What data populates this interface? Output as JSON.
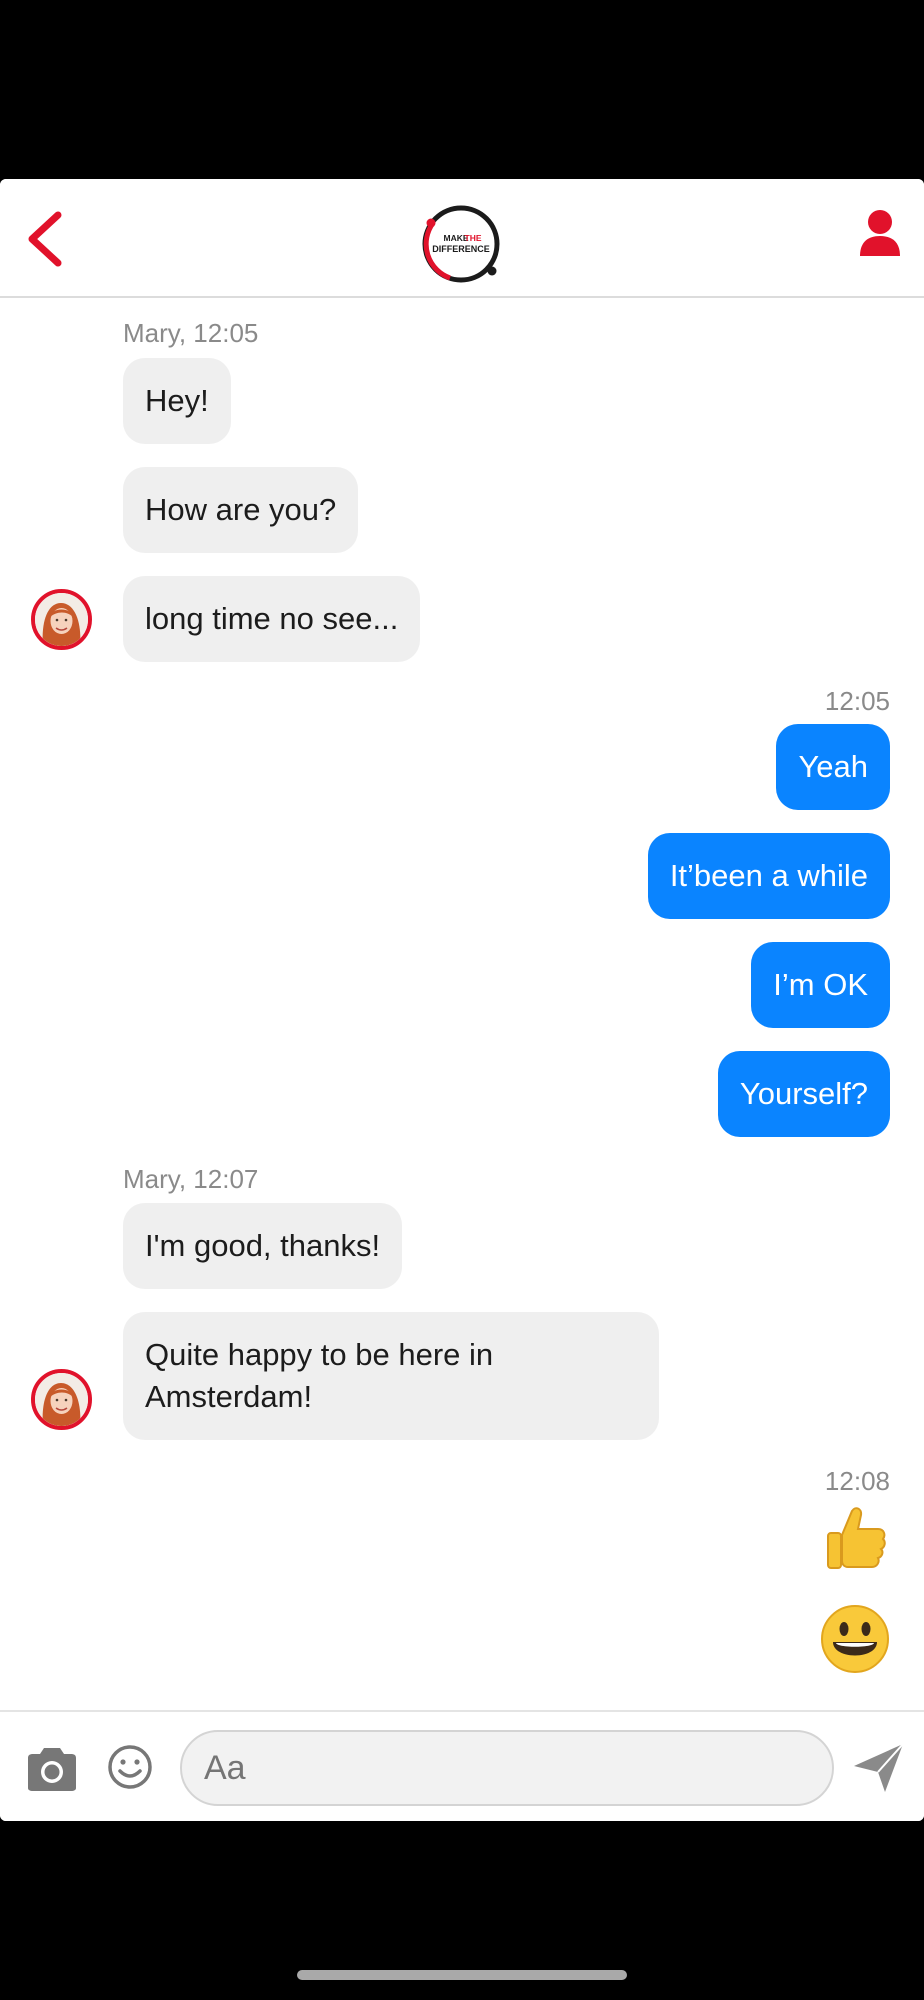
{
  "header": {
    "back_icon": "chevron-left-icon",
    "logo_line1a": "MAKE",
    "logo_line1b": "THE",
    "logo_line2": "DIFFERENCE",
    "profile_icon": "person-icon",
    "accent": "#e1122b"
  },
  "chat": {
    "groups": [
      {
        "ts": "Mary, 12:05",
        "messages": [
          "Hey!",
          "How are you?",
          "long time no see..."
        ]
      },
      {
        "ts": "12:05",
        "messages": [
          "Yeah",
          "It’been a while",
          "I’m OK",
          "Yourself?"
        ]
      },
      {
        "ts": "Mary, 12:07",
        "messages": [
          "I'm good, thanks!",
          "Quite happy to be here in Amsterdam!"
        ]
      },
      {
        "ts": "12:08",
        "emojis": [
          "thumbs-up-icon",
          "grinning-face-icon"
        ]
      }
    ],
    "outgoing_color": "#0a84ff",
    "incoming_color": "#efefef"
  },
  "composer": {
    "placeholder": "Aa",
    "camera_icon": "camera-icon",
    "emoji_icon": "smiley-icon",
    "send_icon": "send-icon"
  }
}
